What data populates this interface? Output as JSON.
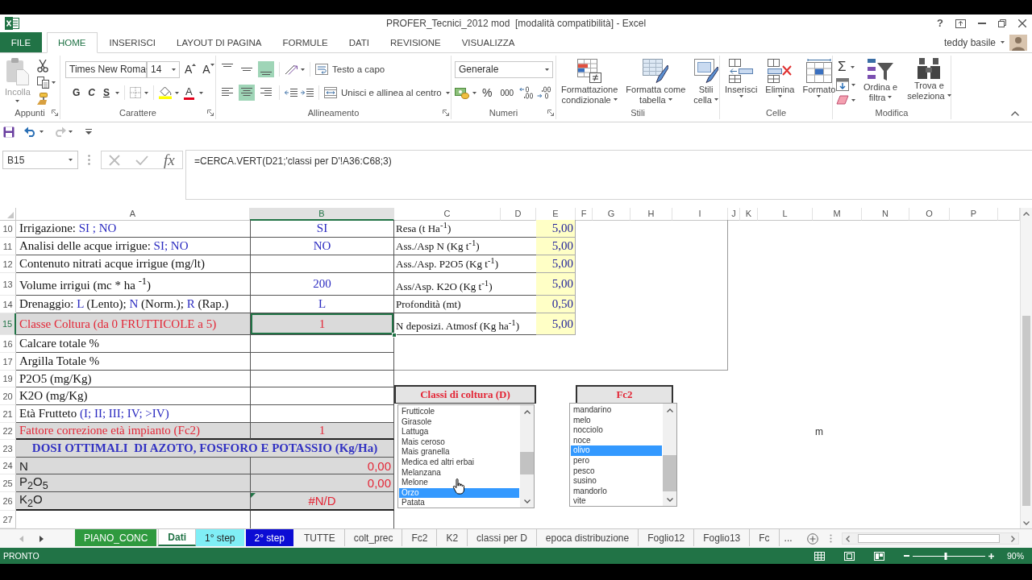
{
  "window": {
    "title": "PROFER_Tecnici_2012 mod  [modalità compatibilità] - Excel",
    "help": "?"
  },
  "account": {
    "user": "teddy basile"
  },
  "ribbon": {
    "tabs": [
      {
        "label": "FILE",
        "kind": "file",
        "selected": false
      },
      {
        "label": "HOME",
        "kind": "tab",
        "selected": true
      },
      {
        "label": "INSERISCI",
        "kind": "tab",
        "selected": false
      },
      {
        "label": "LAYOUT DI PAGINA",
        "kind": "tab",
        "selected": false
      },
      {
        "label": "FORMULE",
        "kind": "tab",
        "selected": false
      },
      {
        "label": "DATI",
        "kind": "tab",
        "selected": false
      },
      {
        "label": "REVISIONE",
        "kind": "tab",
        "selected": false
      },
      {
        "label": "VISUALIZZA",
        "kind": "tab",
        "selected": false
      }
    ],
    "clipboard": {
      "label": "Appunti",
      "paste": {
        "label": "Incolla",
        "disabled": true
      }
    },
    "font": {
      "label": "Carattere",
      "family": "Times New Roma",
      "size": "14",
      "grow": "A",
      "shrink": "A",
      "bold": "G",
      "italic": "C",
      "underline": "S",
      "font_color": "A"
    },
    "alignment": {
      "label": "Allineamento",
      "vertical": [
        {
          "kind": "top",
          "selected": false
        },
        {
          "kind": "middle",
          "selected": false
        },
        {
          "kind": "bottom",
          "selected": true
        }
      ],
      "horizontal": [
        {
          "kind": "left",
          "selected": false
        },
        {
          "kind": "center",
          "selected": true
        },
        {
          "kind": "right",
          "selected": false
        }
      ],
      "wrap": "Testo a capo",
      "merge": "Unisci e allinea al centro"
    },
    "number": {
      "label": "Numeri",
      "format": "Generale",
      "percent": "%",
      "thousands": "000"
    },
    "styles": {
      "label": "Stili",
      "buttons": [
        {
          "kind": "conditional",
          "lines": [
            "Formattazione",
            "condizionale"
          ]
        },
        {
          "kind": "table",
          "lines": [
            "Formatta come",
            "tabella"
          ]
        },
        {
          "kind": "cell_styles",
          "lines": [
            "Stili",
            "cella"
          ]
        }
      ]
    },
    "cells": {
      "label": "Celle",
      "buttons": [
        {
          "kind": "insert",
          "lines": [
            "Inserisci"
          ]
        },
        {
          "kind": "delete",
          "lines": [
            "Elimina"
          ]
        },
        {
          "kind": "format",
          "lines": [
            "Formato"
          ]
        }
      ]
    },
    "editing": {
      "label": "Modifica",
      "autosum": "Σ",
      "buttons": [
        {
          "kind": "sort",
          "lines": [
            "Ordina e",
            "filtra"
          ]
        },
        {
          "kind": "find",
          "lines": [
            "Trova e",
            "seleziona"
          ]
        }
      ]
    }
  },
  "quick_access": [
    {
      "kind": "save",
      "disabled": false
    },
    {
      "kind": "undo",
      "disabled": false
    },
    {
      "kind": "redo",
      "disabled": true
    }
  ],
  "formula_bar": {
    "name_box": "B15",
    "function_button": "fx",
    "formula": "=CERCA.VERT(D21;'classi per D'!A36:C68;3)"
  },
  "sheet": {
    "columns": [
      {
        "label": "A",
        "selected": false
      },
      {
        "label": "B",
        "selected": true
      },
      {
        "label": "C",
        "selected": false
      },
      {
        "label": "D",
        "selected": false
      },
      {
        "label": "E",
        "selected": false
      },
      {
        "label": "F",
        "selected": false
      },
      {
        "label": "G",
        "selected": false
      },
      {
        "label": "H",
        "selected": false
      },
      {
        "label": "I",
        "selected": false
      },
      {
        "label": "J",
        "selected": false
      },
      {
        "label": "K",
        "selected": false
      },
      {
        "label": "L",
        "selected": false
      },
      {
        "label": "M",
        "selected": false
      },
      {
        "label": "N",
        "selected": false
      },
      {
        "label": "O",
        "selected": false
      },
      {
        "label": "P",
        "selected": false
      }
    ],
    "rows": [
      {
        "header": "10",
        "selected": false,
        "kind": "input",
        "label": [
          {
            "kind": "plain",
            "text": "Irrigazione: "
          },
          {
            "kind": "option",
            "text": "SI ; NO"
          }
        ],
        "value": "SI"
      },
      {
        "header": "11",
        "selected": false,
        "kind": "input",
        "label": [
          {
            "kind": "plain",
            "text": "Analisi delle acque irrigue: "
          },
          {
            "kind": "option",
            "text": "SI; NO"
          }
        ],
        "value": "NO"
      },
      {
        "header": "12",
        "selected": false,
        "kind": "input",
        "label": [
          {
            "kind": "plain",
            "text": "Contenuto nitrati acque irrigue (mg/lt)"
          }
        ]
      },
      {
        "header": "13",
        "selected": false,
        "kind": "input",
        "label": [
          {
            "kind": "plain",
            "text": "Volume irrigui (mc * ha $^{-1}$)"
          }
        ],
        "value": "200"
      },
      {
        "header": "14",
        "selected": false,
        "kind": "input",
        "label": [
          {
            "kind": "plain",
            "text": "Drenaggio: "
          },
          {
            "kind": "option",
            "text": "L"
          },
          {
            "kind": "plain",
            "text": " (Lento); "
          },
          {
            "kind": "option",
            "text": "N"
          },
          {
            "kind": "plain",
            "text": " (Norm.); "
          },
          {
            "kind": "option",
            "text": "R"
          },
          {
            "kind": "plain",
            "text": " (Rap.)"
          }
        ],
        "value": "L"
      },
      {
        "header": "15",
        "selected": true,
        "kind": "key",
        "label": [
          {
            "kind": "plain",
            "text": "Classe Coltura (da 0 FRUTTICOLE a 5)"
          }
        ],
        "value": "1"
      },
      {
        "header": "16",
        "selected": false,
        "kind": "input",
        "label": [
          {
            "kind": "plain",
            "text": "Calcare totale %"
          }
        ]
      },
      {
        "header": "17",
        "selected": false,
        "kind": "input",
        "label": [
          {
            "kind": "plain",
            "text": "Argilla Totale %"
          }
        ]
      },
      {
        "header": "19",
        "selected": false,
        "kind": "input",
        "label": [
          {
            "kind": "plain",
            "text": "P2O5 (mg/Kg)"
          }
        ]
      },
      {
        "header": "20",
        "selected": false,
        "kind": "input",
        "label": [
          {
            "kind": "plain",
            "text": "K2O (mg/Kg)"
          }
        ]
      },
      {
        "header": "21",
        "selected": false,
        "kind": "input",
        "label": [
          {
            "kind": "plain",
            "text": "Età Frutteto "
          },
          {
            "kind": "option",
            "text": "(I; II; III; IV; >IV)"
          }
        ]
      },
      {
        "header": "22",
        "selected": false,
        "kind": "key",
        "label": [
          {
            "kind": "plain",
            "text": "Fattore correzione età impianto (Fc2)"
          }
        ],
        "value": "1",
        "column_m": "m"
      },
      {
        "header": "23",
        "selected": false,
        "kind": "heading",
        "label": [
          {
            "kind": "plain",
            "text": "DOSI OTTIMALI  DI AZOTO, FOSFORO E POTASSIO (Kg/Ha)"
          }
        ]
      },
      {
        "header": "24",
        "selected": false,
        "kind": "result",
        "label": [
          {
            "kind": "plain",
            "text": "N"
          }
        ],
        "value": "0,00"
      },
      {
        "header": "25",
        "selected": false,
        "kind": "result",
        "label": [
          {
            "kind": "plain",
            "text": "P$_{2}$O$_{5}$"
          }
        ],
        "value": "0,00"
      },
      {
        "header": "26",
        "selected": false,
        "kind": "error",
        "label": [
          {
            "kind": "plain",
            "text": "K$_{2}$O"
          }
        ],
        "value": "#N/D"
      },
      {
        "header": "27",
        "selected": false,
        "kind": "empty"
      }
    ],
    "parameters": [
      {
        "label": "Resa (t Ha$^{-1}$)",
        "value": "5,00"
      },
      {
        "label": "Ass./Asp N (Kg t$^{-1}$)",
        "value": "5,00"
      },
      {
        "label": "Ass./Asp. P2O5 (Kg t$^{-1}$)",
        "value": "5,00"
      },
      {
        "label": "Ass/Asp. K2O (Kg t$^{-1}$)",
        "value": "5,00"
      },
      {
        "label": "Profondità (mt)",
        "value": "0,50"
      },
      {
        "label": "N deposizi. Atmosf (Kg ha$^{-1}$)",
        "value": "5,00"
      }
    ]
  },
  "list_boxes": [
    {
      "title": "Classi di coltura (D)",
      "items": [
        {
          "label": "Frutticole",
          "selected": false
        },
        {
          "label": "Girasole",
          "selected": false
        },
        {
          "label": "Lattuga",
          "selected": false
        },
        {
          "label": "Mais ceroso",
          "selected": false
        },
        {
          "label": "Mais granella",
          "selected": false
        },
        {
          "label": "Medica ed altri erbai",
          "selected": false
        },
        {
          "label": "Melanzana",
          "selected": false
        },
        {
          "label": "Melone",
          "selected": false
        },
        {
          "label": "Orzo",
          "selected": true
        },
        {
          "label": "Patata",
          "selected": false
        }
      ]
    },
    {
      "title": "Fc2",
      "items": [
        {
          "label": "mandarino",
          "selected": false
        },
        {
          "label": "melo",
          "selected": false
        },
        {
          "label": "nocciolo",
          "selected": false
        },
        {
          "label": "noce",
          "selected": false
        },
        {
          "label": "olivo",
          "selected": true
        },
        {
          "label": "pero",
          "selected": false
        },
        {
          "label": "pesco",
          "selected": false
        },
        {
          "label": "susino",
          "selected": false
        },
        {
          "label": "mandorlo",
          "selected": false
        },
        {
          "label": "vite",
          "selected": false
        }
      ]
    }
  ],
  "sheet_tabs": {
    "tabs": [
      {
        "label": "PIANO_CONC",
        "selected": false,
        "color": "#2f9a3f"
      },
      {
        "label": "Dati",
        "selected": true
      },
      {
        "label": "1° step",
        "selected": false,
        "color": "#80eef6"
      },
      {
        "label": "2° step",
        "selected": false,
        "color": "#0c0cd4"
      },
      {
        "label": "TUTTE",
        "selected": false
      },
      {
        "label": "colt_prec",
        "selected": false
      },
      {
        "label": "Fc2",
        "selected": false
      },
      {
        "label": "K2",
        "selected": false
      },
      {
        "label": "classi per D",
        "selected": false
      },
      {
        "label": "epoca distribuzione",
        "selected": false
      },
      {
        "label": "Foglio12",
        "selected": false
      },
      {
        "label": "Foglio13",
        "selected": false
      },
      {
        "label": "Fc",
        "selected": false
      }
    ],
    "more": "..."
  },
  "status_bar": {
    "mode": "PRONTO",
    "zoom": {
      "level": 0.46,
      "reading": "90%"
    }
  }
}
